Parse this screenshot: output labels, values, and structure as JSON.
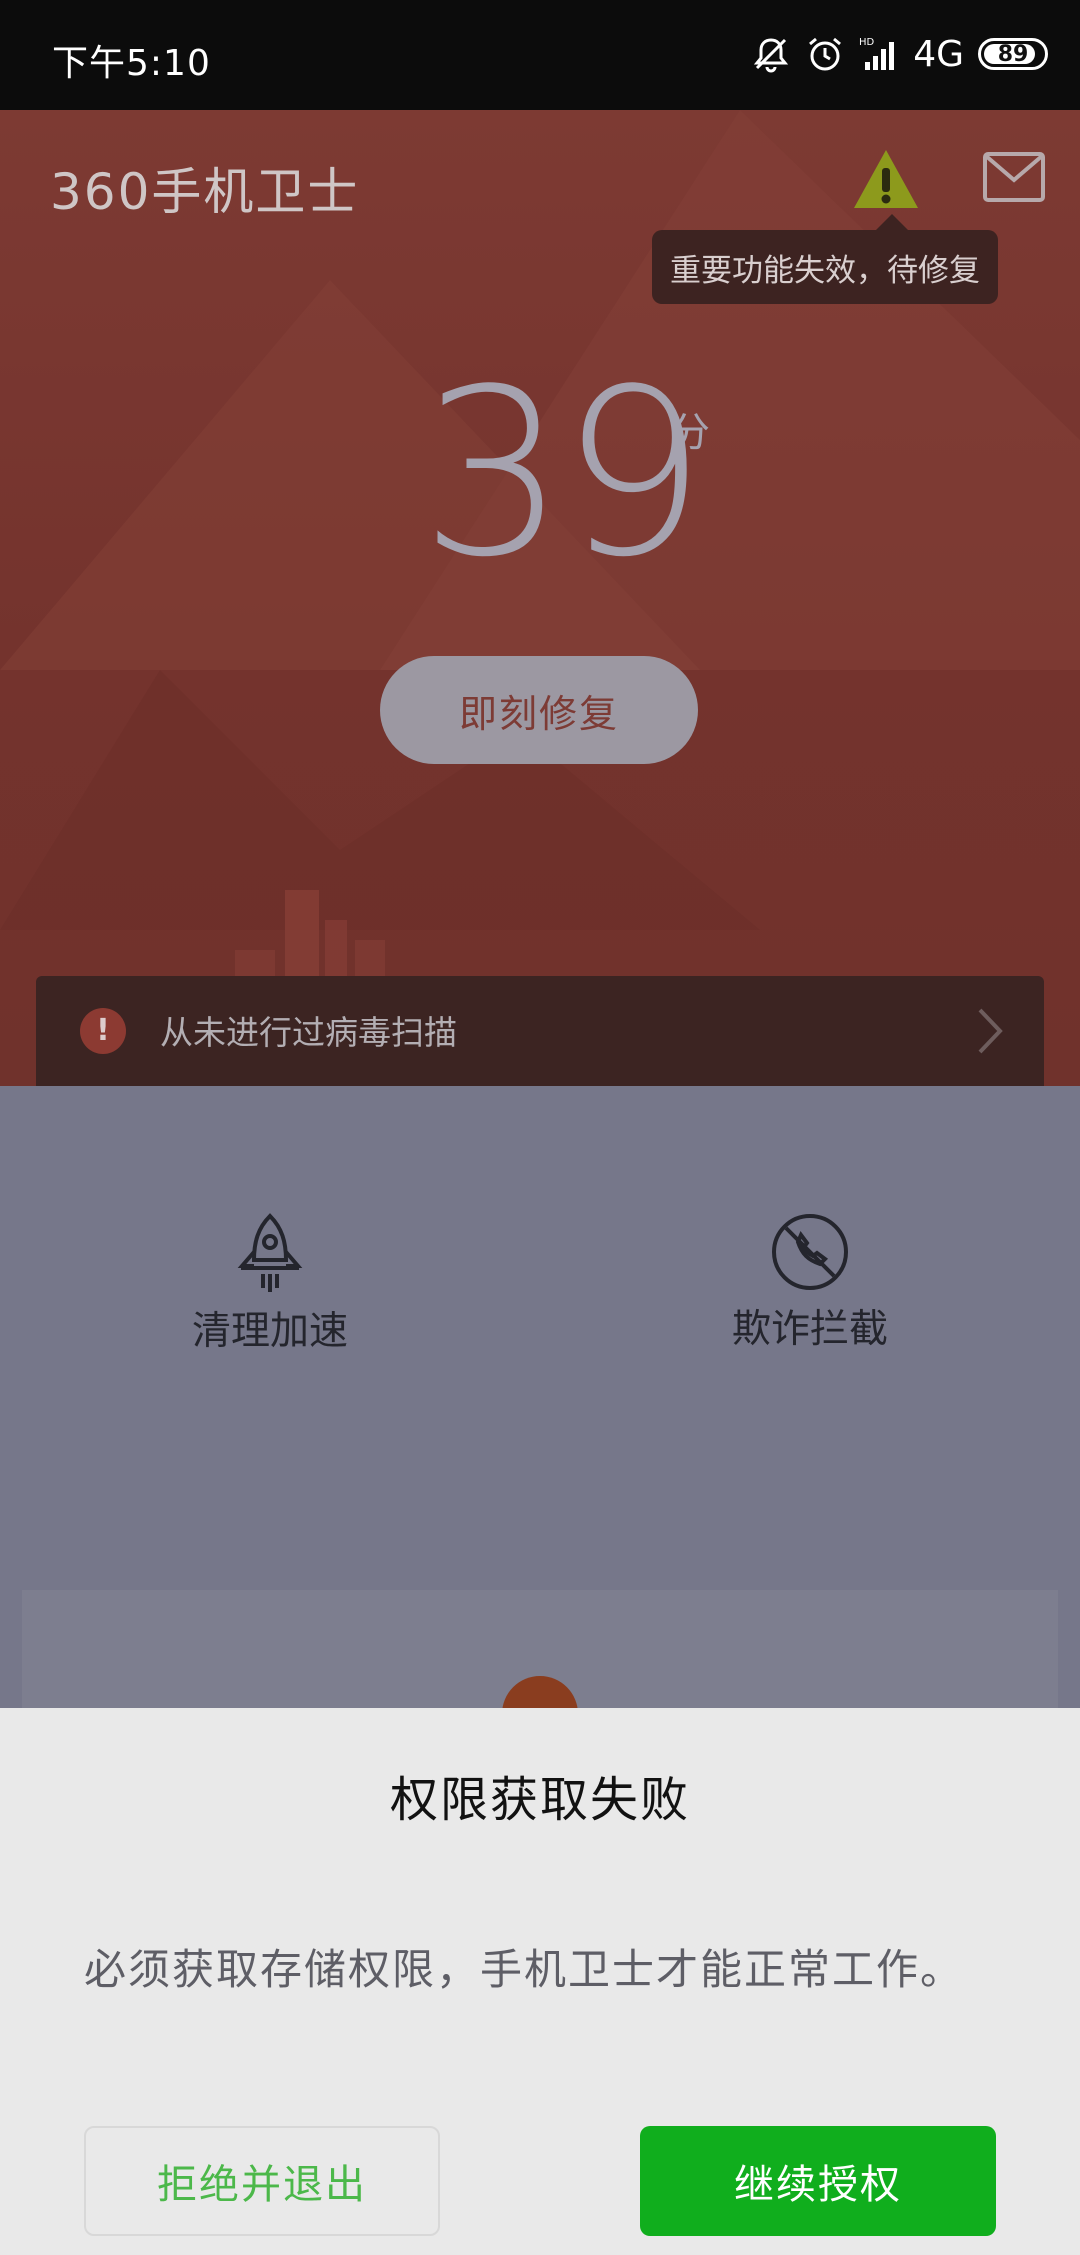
{
  "status_bar": {
    "time": "下午5:10",
    "network": "4G",
    "battery": "89",
    "battery_fraction": 0.89
  },
  "header": {
    "logo": "360手机卫士",
    "tooltip": "重要功能失效，待修复",
    "score": "39",
    "score_unit": "分",
    "fix_button": "即刻修复",
    "alert_text": "从未进行过病毒扫描"
  },
  "features": [
    {
      "label": "清理加速",
      "icon": "rocket-icon"
    },
    {
      "label": "欺诈拦截",
      "icon": "blocked-call-icon"
    }
  ],
  "dialog": {
    "title": "权限获取失败",
    "message": "必须获取存储权限，手机卫士才能正常工作。",
    "reject_button": "拒绝并退出",
    "continue_button": "继续授权"
  },
  "colors": {
    "header_red": "#7d3a33",
    "content_grey": "#76778a",
    "dialog_bg": "#e9e9e9",
    "accent_green": "#10ae1d",
    "reject_text_green": "#4cb84a",
    "warning_yellow": "#8d9a1c"
  }
}
